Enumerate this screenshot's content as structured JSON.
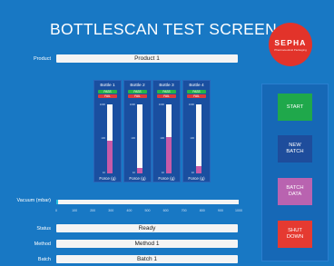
{
  "title": "BOTTLESCAN TEST SCREEN",
  "logo": {
    "text": "SEPHA",
    "subtext": "Pharmaceutical Packaging"
  },
  "product": {
    "label": "Product",
    "value": "Product 1"
  },
  "bottles": [
    {
      "name": "Bottle 1",
      "pass_label": "PASS",
      "fail_label": "FAIL",
      "scale_top": "1000",
      "scale_mid": "100",
      "scale_bottom": "10",
      "fill_fraction": 0.48,
      "force_label": "Force (g)"
    },
    {
      "name": "Bottle 2",
      "pass_label": "PASS",
      "fail_label": "FAIL",
      "scale_top": "1000",
      "scale_mid": "100",
      "scale_bottom": "10",
      "fill_fraction": 0.08,
      "force_label": "Force (g)"
    },
    {
      "name": "Bottle 3",
      "pass_label": "PASS",
      "fail_label": "FAIL",
      "scale_top": "1000",
      "scale_mid": "100",
      "scale_bottom": "10",
      "fill_fraction": 0.52,
      "force_label": "Force (g)"
    },
    {
      "name": "Bottle 4",
      "pass_label": "PASS",
      "fail_label": "FAIL",
      "scale_top": "1000",
      "scale_mid": "100",
      "scale_bottom": "10",
      "fill_fraction": 0.1,
      "force_label": "Force (g)"
    }
  ],
  "vacuum": {
    "label": "Vacuum (mbar)",
    "fraction": 0.01,
    "ticks": [
      "0",
      "100",
      "200",
      "300",
      "400",
      "500",
      "600",
      "700",
      "800",
      "900",
      "1000"
    ]
  },
  "status": {
    "label": "Status",
    "value": "Ready"
  },
  "method": {
    "label": "Method",
    "value": "Method 1"
  },
  "batch": {
    "label": "Batch",
    "value": "Batch 1"
  },
  "buttons": {
    "start": "START",
    "new_batch": "NEW\nBATCH",
    "batch_data": "BATCH\nDATA",
    "shut_down": "SHUT\nDOWN"
  },
  "colors": {
    "background": "#1878c4",
    "pass": "#27b34a",
    "fail": "#e03a3a",
    "force_fill": "#c85aa8",
    "vacuum_fill": "#27c0e0",
    "start": "#1fa84b",
    "new_batch": "#1e4d9c",
    "batch_data": "#b963b0",
    "shut_down": "#e53a31",
    "logo": "#e2332a"
  }
}
